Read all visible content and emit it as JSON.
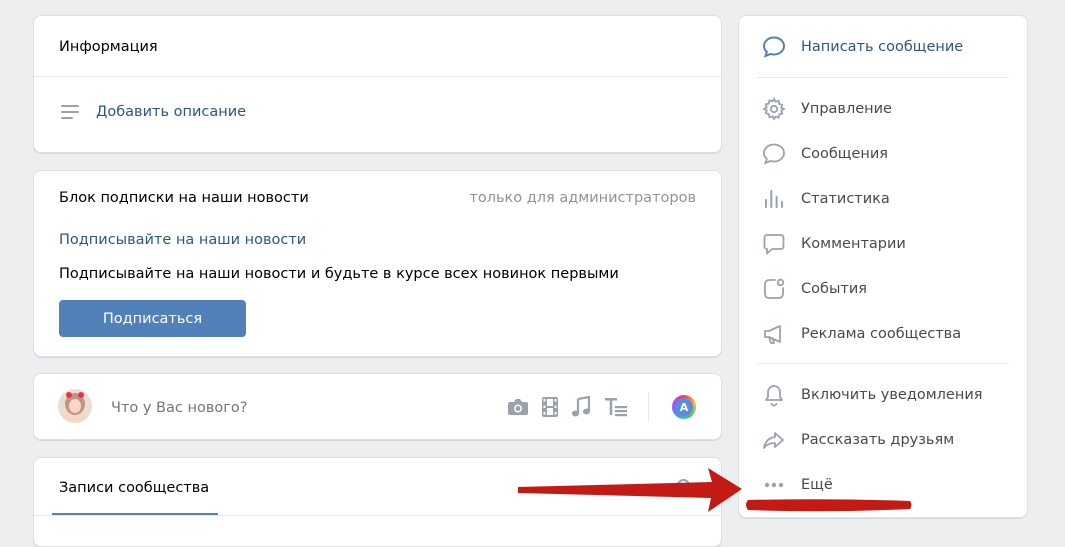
{
  "info_card": {
    "title": "Информация",
    "add_description": "Добавить описание"
  },
  "subscribe_card": {
    "title": "Блок подписки на наши новости",
    "admin_note": "только для администраторов",
    "link": "Подписывайте на наши новости",
    "text": "Подписывайте на наши новости и будьте в курсе всех новинок первыми",
    "button": "Подписаться"
  },
  "post_box": {
    "placeholder": "Что у Вас нового?",
    "avatar_letter": "A"
  },
  "wall_card": {
    "tab": "Записи сообщества"
  },
  "right_menu": {
    "write_message": "Написать сообщение",
    "manage": "Управление",
    "messages": "Сообщения",
    "stats": "Статистика",
    "comments": "Комментарии",
    "events": "События",
    "ads": "Реклама сообщества",
    "notifications": "Включить уведомления",
    "share": "Рассказать друзьям",
    "more": "Ещё"
  },
  "colors": {
    "accent": "#5181b8",
    "link": "#2a5885",
    "annotation_red": "#c41a16"
  }
}
